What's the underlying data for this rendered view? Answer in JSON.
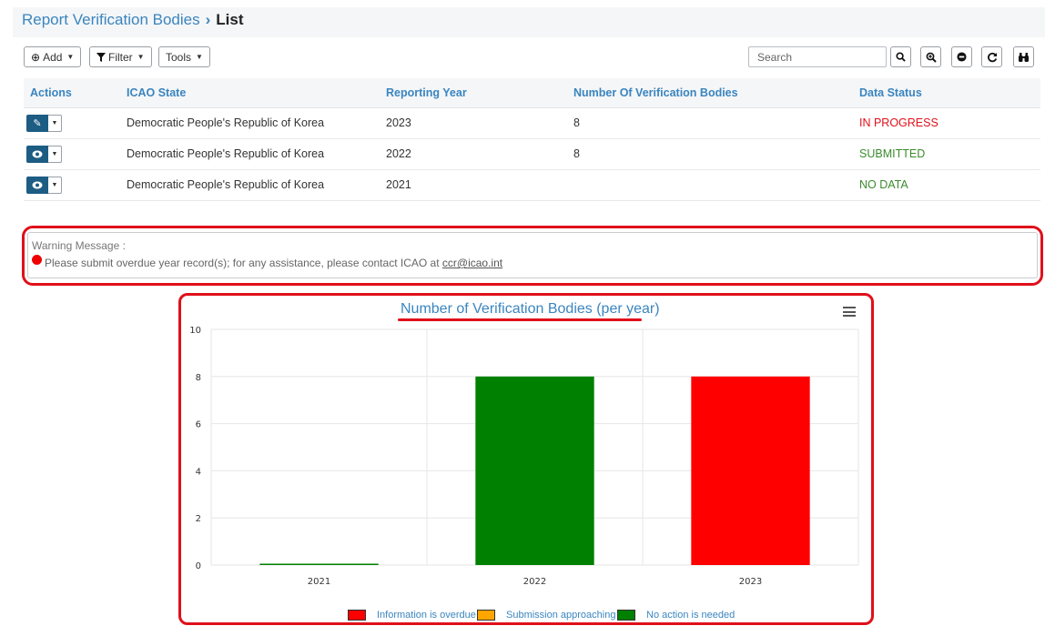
{
  "breadcrumb": {
    "parent": "Report Verification Bodies",
    "separator": "›",
    "current": "List"
  },
  "toolbar": {
    "add_label": "Add",
    "filter_label": "Filter",
    "tools_label": "Tools",
    "search_placeholder": "Search"
  },
  "table": {
    "columns": [
      "Actions",
      "ICAO State",
      "Reporting Year",
      "Number Of Verification Bodies",
      "Data Status"
    ],
    "rows": [
      {
        "action_icon": "pencil-icon",
        "state": "Democratic People's Republic of Korea",
        "year": "2023",
        "count": "8",
        "status": "IN PROGRESS",
        "status_color": "#e0101a"
      },
      {
        "action_icon": "eye-icon",
        "state": "Democratic People's Republic of Korea",
        "year": "2022",
        "count": "8",
        "status": "SUBMITTED",
        "status_color": "#3c8a2e"
      },
      {
        "action_icon": "eye-icon",
        "state": "Democratic People's Republic of Korea",
        "year": "2021",
        "count": "",
        "status": "NO DATA",
        "status_color": "#3c8a2e"
      }
    ]
  },
  "warning": {
    "title": "Warning Message :",
    "text": "Please submit overdue year record(s); for any assistance, please contact ICAO at",
    "email": "ccr@icao.int"
  },
  "chart_data": {
    "type": "bar",
    "title": "Number of Verification Bodies (per year)",
    "categories": [
      "2021",
      "2022",
      "2023"
    ],
    "values": [
      0,
      8,
      8
    ],
    "colors": [
      "#008000",
      "#008000",
      "#ff0000"
    ],
    "ylim": [
      0,
      10
    ],
    "yticks": [
      0,
      2,
      4,
      6,
      8,
      10
    ],
    "grid": true,
    "legend_position": "bottom",
    "legend": [
      {
        "label": "Information is overdue",
        "color": "#ff0000"
      },
      {
        "label": "Submission approaching",
        "color": "#ffa500"
      },
      {
        "label": "No action is needed",
        "color": "#008000"
      }
    ]
  }
}
